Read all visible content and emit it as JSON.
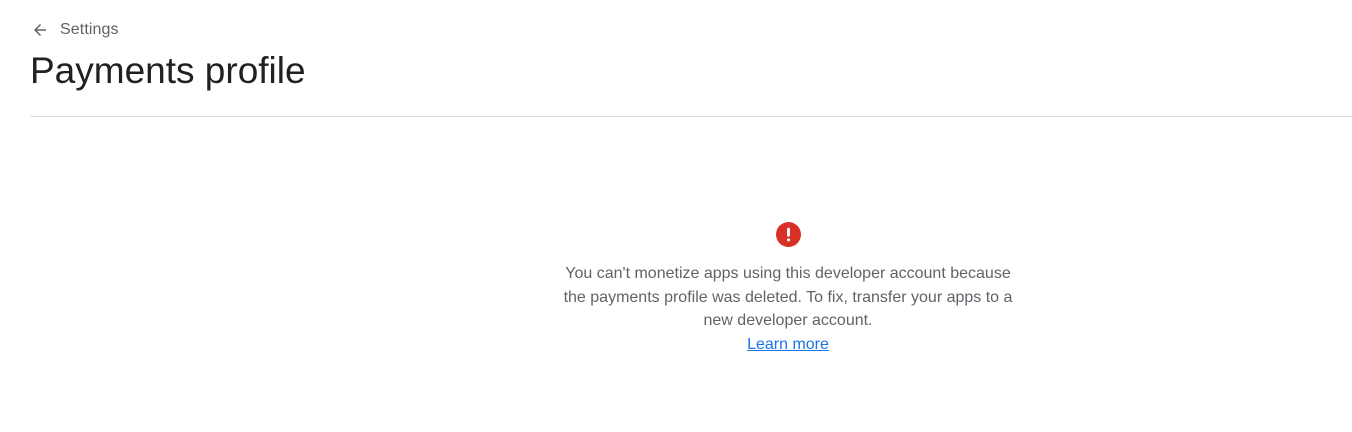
{
  "header": {
    "back_label": "Settings",
    "back_icon": "arrow-back-icon",
    "title": "Payments profile"
  },
  "empty_state": {
    "icon": "error-icon",
    "icon_color": "#d93025",
    "message": "You can't monetize apps using this developer account because the payments profile was deleted. To fix, transfer your apps to a new developer account.",
    "link_label": "Learn more",
    "link_color": "#1a73e8"
  }
}
